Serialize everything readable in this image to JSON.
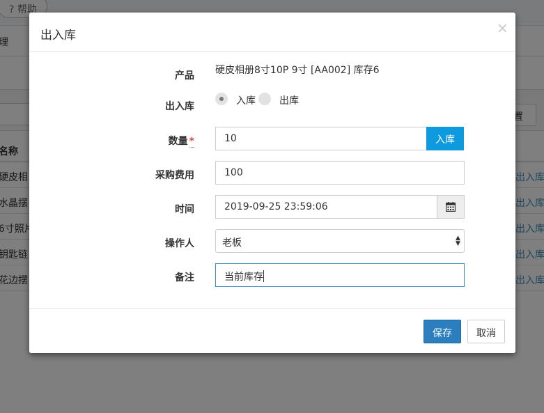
{
  "background": {
    "help_label": "? 帮助",
    "subheader_text": "理",
    "settings_button": "置",
    "table_header": "名称",
    "rows": [
      {
        "name": "硬皮相",
        "action": "出入库"
      },
      {
        "name": "水晶摆",
        "action": "出入库"
      },
      {
        "name": "6寸照片",
        "action": "出入库"
      },
      {
        "name": "钥匙链",
        "action": "出入库"
      },
      {
        "name": "花边摆",
        "action": "出入库"
      }
    ]
  },
  "modal": {
    "title": "出入库",
    "close": "×",
    "product_label": "产品",
    "product_value": "硬皮相册8寸10P 9寸 [AA002] 库存6",
    "direction_label": "出入库",
    "direction_options": [
      {
        "label": "入库",
        "checked": true
      },
      {
        "label": "出库",
        "checked": false
      }
    ],
    "quantity_label": "数量",
    "required_mark": "*",
    "quantity_value": "10",
    "quantity_addon": "入库",
    "cost_label": "采购费用",
    "cost_value": "100",
    "time_label": "时间",
    "time_value": "2019-09-25 23:59:06",
    "operator_label": "操作人",
    "operator_value": "老板",
    "note_label": "备注",
    "note_value": "当前库存",
    "save_button": "保存",
    "cancel_button": "取消"
  },
  "icons": {
    "calendar": "calendar-icon",
    "select_arrows": "chevron-updown-icon",
    "close": "close-icon"
  },
  "colors": {
    "primary": "#2c7fbf",
    "addon": "#0e9ade",
    "link": "#3c8dbc",
    "required": "#dd4b39"
  }
}
